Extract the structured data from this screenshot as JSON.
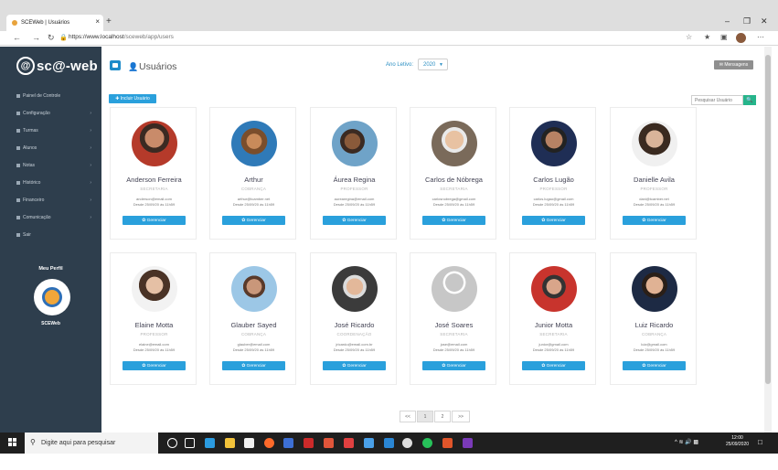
{
  "browser": {
    "tab_title": "SCEWeb | Usuários",
    "tab_close": "×",
    "new_tab": "+",
    "url_prefix": "https://",
    "url_host": "www.localhost",
    "url_path": "/sceweb/app/users"
  },
  "sidebar": {
    "logo_mark": "@",
    "logo_text": "sc@-web",
    "items": [
      {
        "label": "Painel de Controle",
        "has_chevron": false
      },
      {
        "label": "Configuração",
        "has_chevron": true
      },
      {
        "label": "Turmas",
        "has_chevron": true
      },
      {
        "label": "Alunos",
        "has_chevron": true
      },
      {
        "label": "Notas",
        "has_chevron": true
      },
      {
        "label": "Histórico",
        "has_chevron": true
      },
      {
        "label": "Financeiro",
        "has_chevron": true
      },
      {
        "label": "Comunicação",
        "has_chevron": true
      },
      {
        "label": "Sair",
        "has_chevron": false
      }
    ],
    "chevron": "›",
    "profile_title": "Meu Perfil",
    "profile_name": "SCEWeb"
  },
  "header": {
    "title": "Usuários",
    "year_label": "Ano Letivo:",
    "year_value": "2020",
    "messages_label": "✉ Mensagens"
  },
  "toolbar": {
    "add_user_label": "✚ Incluir Usuário",
    "search_placeholder": "Pesquisar Usuário",
    "search_icon": "🔍"
  },
  "manage_label": "✿ Gerenciar",
  "users": [
    {
      "name": "Anderson Ferreira",
      "role": "SECRETARIA",
      "email": "anderson@email.com",
      "since": "Desde 25/09/20 às 11h59",
      "photo": "ph-a"
    },
    {
      "name": "Arthur",
      "role": "COBRANÇA",
      "email": "arthur@tcamber.net",
      "since": "Desde 25/09/20 às 11h59",
      "photo": "ph-b"
    },
    {
      "name": "Áurea Regina",
      "role": "PROFESSOR",
      "email": "aurearegina@email.com",
      "since": "Desde 25/09/20 às 11h59",
      "photo": "ph-c"
    },
    {
      "name": "Carlos de Nóbrega",
      "role": "SECRETARIA",
      "email": "carlosnobrega@gmail.com",
      "since": "Desde 25/09/20 às 11h59",
      "photo": "ph-d"
    },
    {
      "name": "Carlos Lugão",
      "role": "PROFESSOR",
      "email": "carlos.lugao@gmail.com",
      "since": "Desde 25/09/20 às 11h59",
      "photo": "ph-e"
    },
    {
      "name": "Danielle Avila",
      "role": "PROFESSOR",
      "email": "dani@tcamber.net",
      "since": "Desde 25/09/20 às 11h59",
      "photo": "ph-f"
    },
    {
      "name": "Elaine Motta",
      "role": "PROFESSOR",
      "email": "elaine@email.com",
      "since": "Desde 25/09/20 às 11h59",
      "photo": "ph-g"
    },
    {
      "name": "Glauber Sayed",
      "role": "COBRANÇA",
      "email": "glauber@email.com",
      "since": "Desde 25/09/20 às 11h59",
      "photo": "ph-h"
    },
    {
      "name": "José Ricardo",
      "role": "COORDENAÇÃO",
      "email": "jricardo@email.com.br",
      "since": "Desde 25/09/20 às 11h59",
      "photo": "ph-i"
    },
    {
      "name": "José Soares",
      "role": "SECRETARIA",
      "email": "jose@email.com",
      "since": "Desde 25/09/20 às 11h59",
      "photo": "ph-j"
    },
    {
      "name": "Junior Motta",
      "role": "SECRETARIA",
      "email": "junior@gmail.com",
      "since": "Desde 25/09/20 às 11h59",
      "photo": "ph-k"
    },
    {
      "name": "Luiz Ricardo",
      "role": "COBRANÇA",
      "email": "luiz@gmail.com",
      "since": "Desde 25/09/20 às 11h59",
      "photo": "ph-l"
    }
  ],
  "pagination": {
    "prev": "<<",
    "pages": [
      "1",
      "2"
    ],
    "next": ">>",
    "active": "1"
  },
  "taskbar": {
    "search_placeholder": "Digite aqui para pesquisar",
    "time": "12:00",
    "date": "25/09/2020"
  },
  "colors": {
    "accent": "#2aa0dc",
    "sidebar": "#2e3e4d",
    "search_green": "#26b58b"
  }
}
